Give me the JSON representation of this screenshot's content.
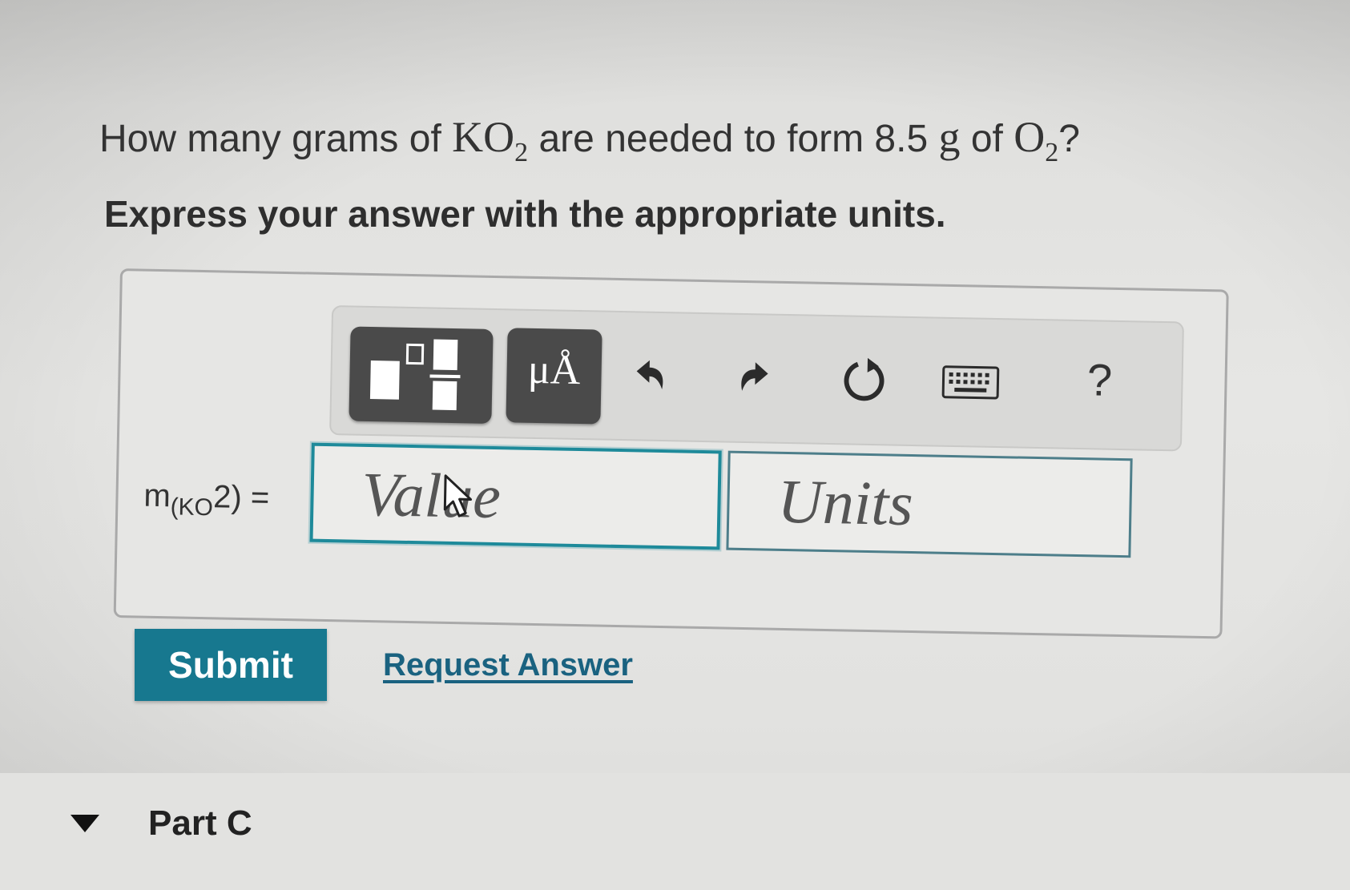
{
  "question": {
    "prefix": "How many grams of",
    "compound": "KO",
    "compound_sub": "2",
    "middle": "are needed to form 8.5",
    "unit_g": "g",
    "of": "of",
    "product": "O",
    "product_sub": "2",
    "suffix": "?"
  },
  "instruction": "Express your answer with the appropriate units.",
  "toolbar": {
    "templates_icon": "fraction-template-icon",
    "units_label": "μÅ",
    "undo_icon": "undo-icon",
    "redo_icon": "redo-icon",
    "reset_icon": "reset-icon",
    "keyboard_icon": "keyboard-icon",
    "help_label": "?"
  },
  "equation": {
    "var": "m",
    "sub": "(KO",
    "tail": "2) ="
  },
  "fields": {
    "value_placeholder": "Value",
    "units_placeholder": "Units"
  },
  "actions": {
    "submit": "Submit",
    "request_answer": "Request Answer"
  },
  "part": {
    "label": "Part C"
  },
  "colors": {
    "accent": "#17788f",
    "link": "#1a6280",
    "focus_border": "#1e8a9a"
  }
}
